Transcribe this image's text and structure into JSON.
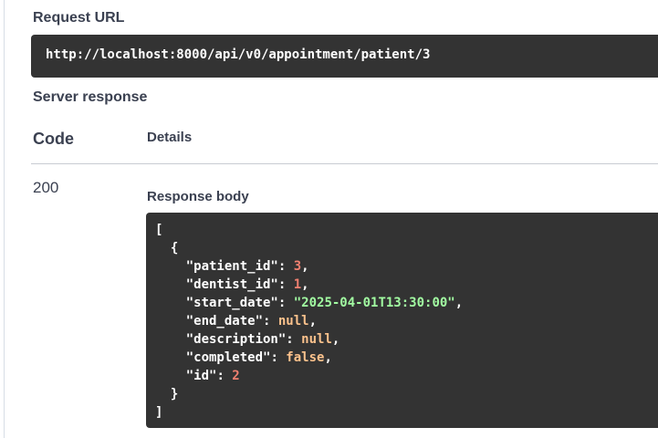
{
  "request_url": {
    "label": "Request URL",
    "value": "http://localhost:8000/api/v0/appointment/patient/3"
  },
  "server_response": {
    "label": "Server response",
    "columns": {
      "code": "Code",
      "details": "Details"
    },
    "row": {
      "code": "200",
      "response_body_label": "Response body"
    },
    "body": {
      "open_bracket": "[",
      "open_brace": "{",
      "close_brace": "}",
      "close_bracket": "]",
      "fields": [
        {
          "key": "\"patient_id\"",
          "value": "3",
          "type": "number"
        },
        {
          "key": "\"dentist_id\"",
          "value": "1",
          "type": "number"
        },
        {
          "key": "\"start_date\"",
          "value": "\"2025-04-01T13:30:00\"",
          "type": "string"
        },
        {
          "key": "\"end_date\"",
          "value": "null",
          "type": "keyword"
        },
        {
          "key": "\"description\"",
          "value": "null",
          "type": "keyword"
        },
        {
          "key": "\"completed\"",
          "value": "false",
          "type": "keyword"
        },
        {
          "key": "\"id\"",
          "value": "2",
          "type": "number"
        }
      ]
    }
  },
  "colors": {
    "code_background": "#333333",
    "number": "#f18070",
    "string": "#a2fca2",
    "keyword": "#fcc28c",
    "text": "#3b4151"
  }
}
